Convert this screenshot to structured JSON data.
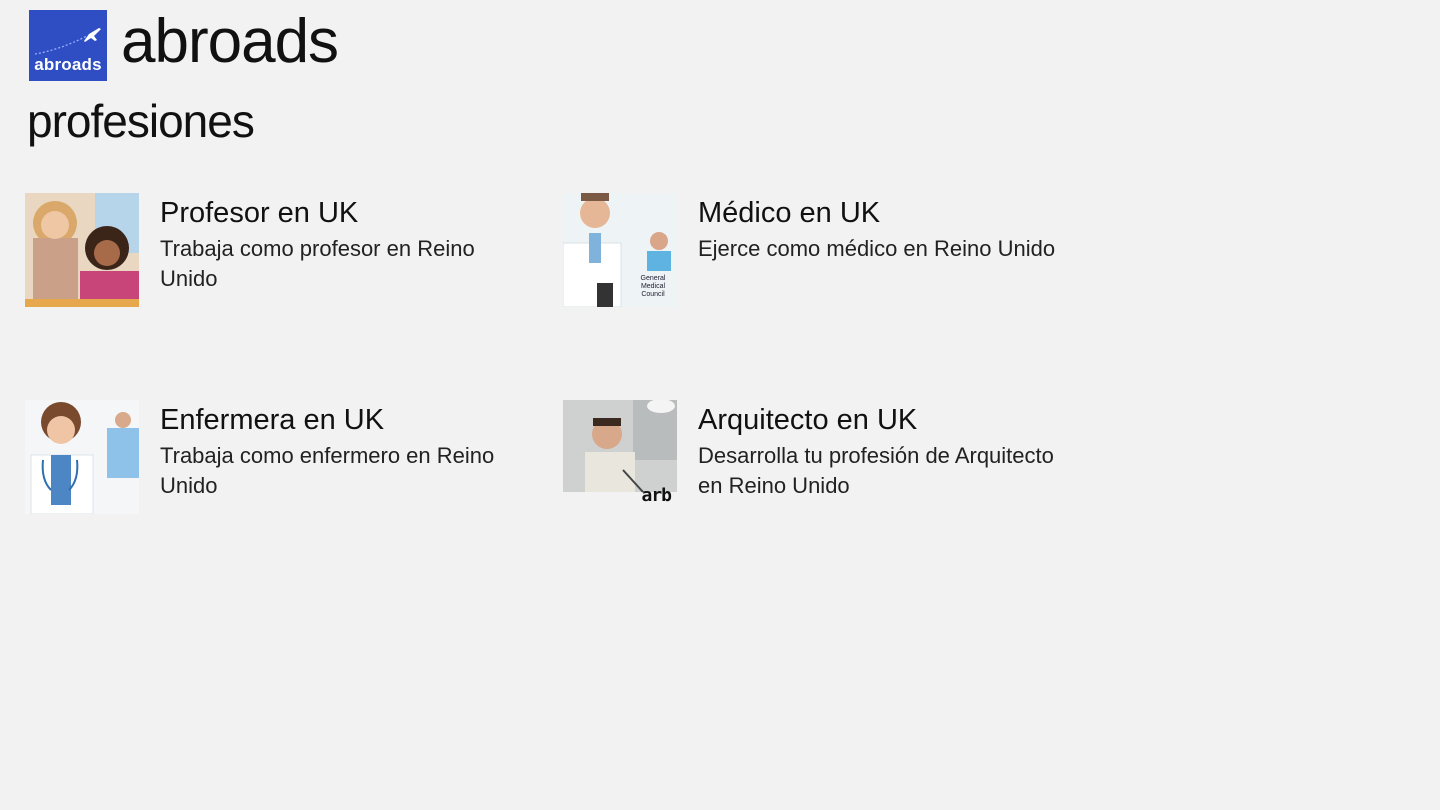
{
  "app": {
    "title": "abroads",
    "logo_text": "abroads",
    "brand_color": "#2f4ec4"
  },
  "page": {
    "title": "profesiones"
  },
  "items": [
    {
      "title": "Profesor en UK",
      "subtitle": "Trabaja como profesor en Reino Unido",
      "image": "teacher-photo"
    },
    {
      "title": "Médico en UK",
      "subtitle": "Ejerce como médico en Reino Unido",
      "image": "doctor-photo",
      "image_caption": "General Medical Council"
    },
    {
      "title": "Enfermera en UK",
      "subtitle": "Trabaja como enfermero en Reino Unido",
      "image": "nurse-photo"
    },
    {
      "title": "Arquitecto en UK",
      "subtitle": "Desarrolla tu profesión de Arquitecto en Reino Unido",
      "image": "architect-photo",
      "image_caption": "arb"
    }
  ]
}
